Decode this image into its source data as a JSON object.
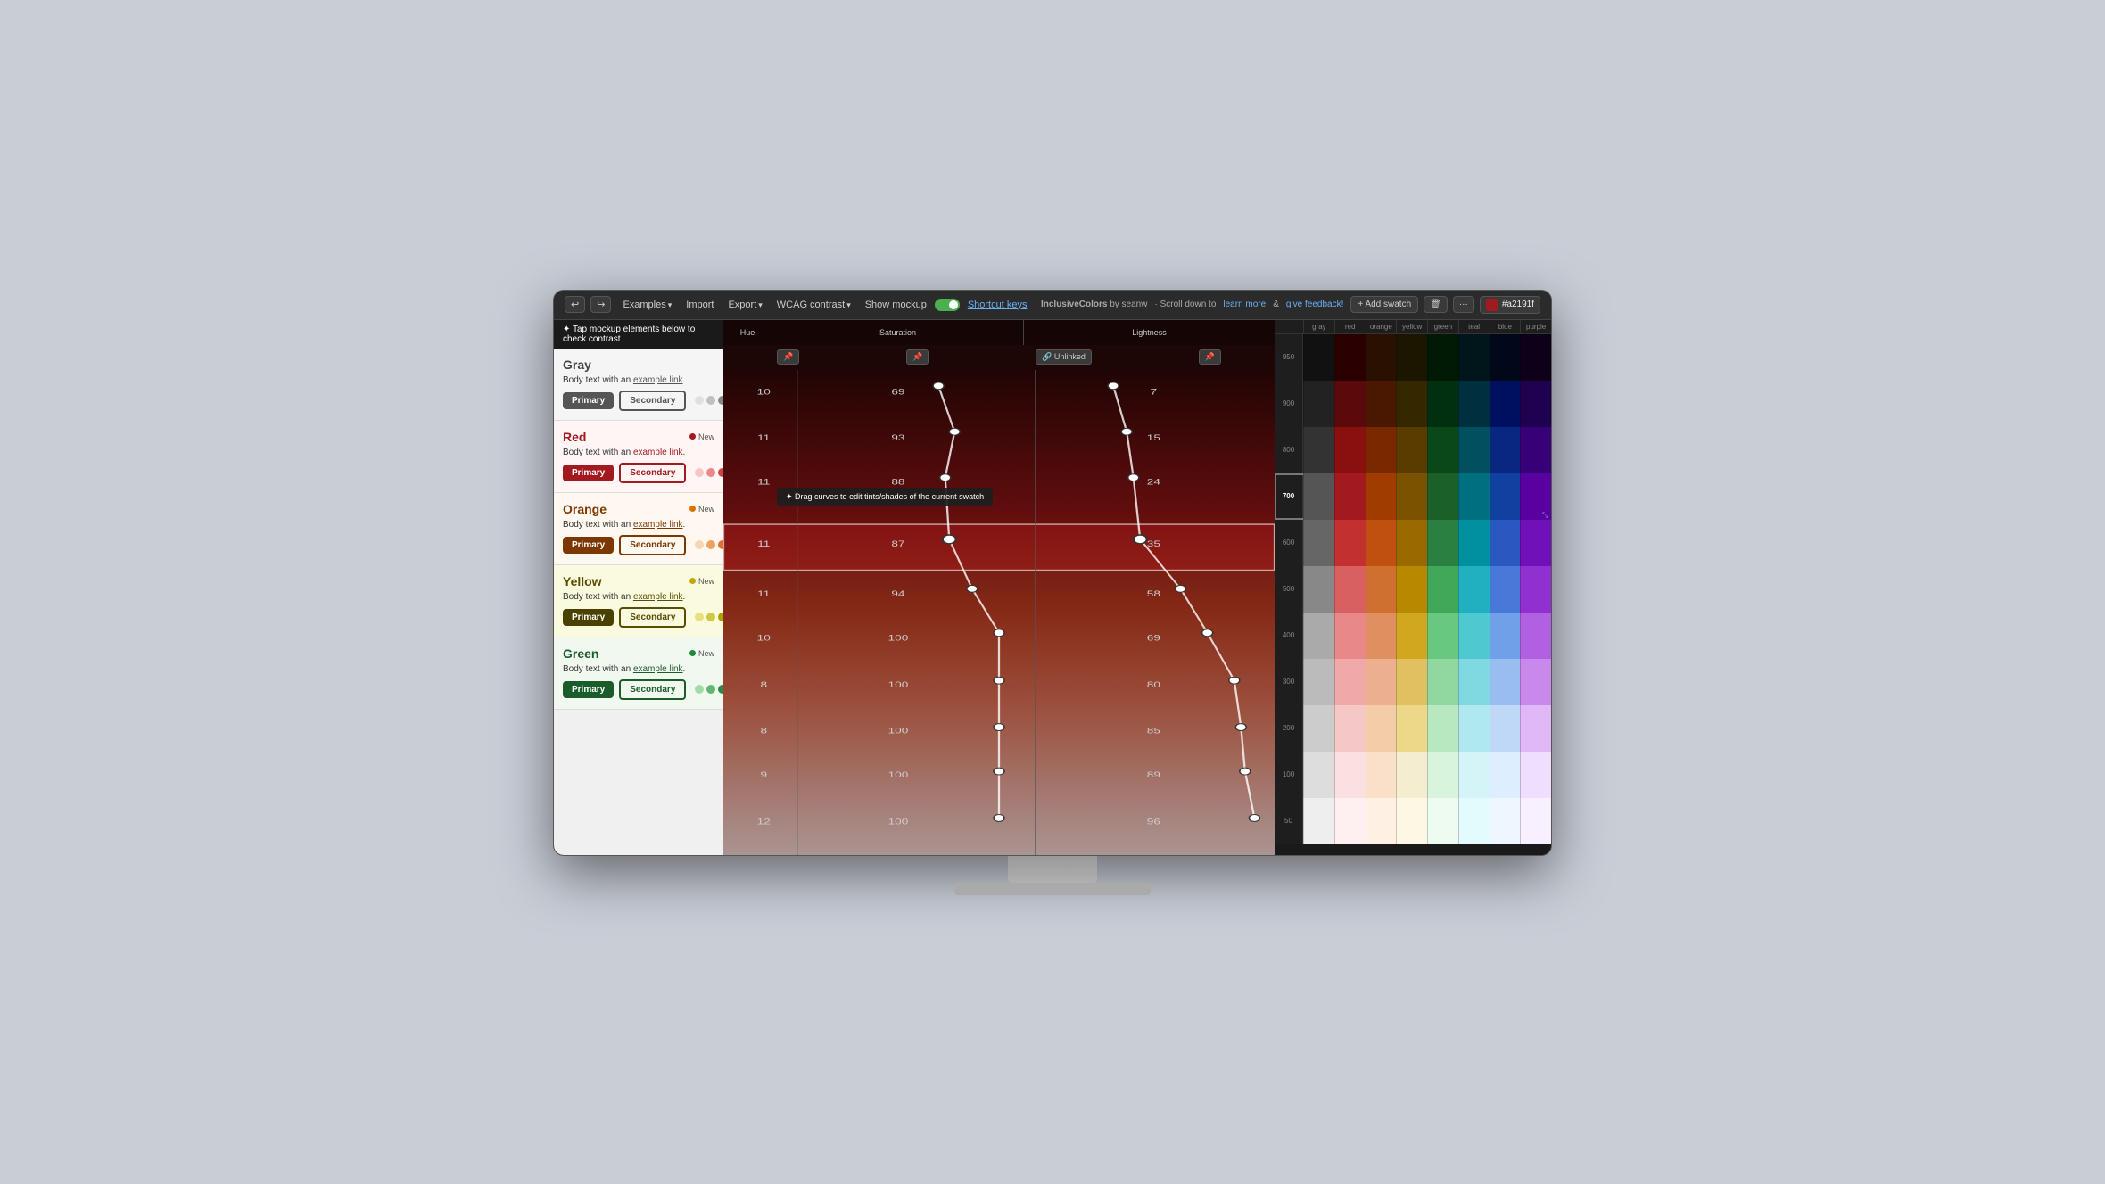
{
  "app": {
    "title": "InclusiveColors",
    "attribution": "by seanw",
    "scroll_hint": "· Scroll down to",
    "learn_more": "learn more",
    "and": "&",
    "give_feedback": "give feedback!"
  },
  "topbar": {
    "undo_label": "↩",
    "redo_label": "↪",
    "examples_label": "Examples",
    "import_label": "Import",
    "export_label": "Export",
    "wcag_label": "WCAG contrast",
    "show_mockup_label": "Show mockup",
    "shortcut_keys_label": "Shortcut keys",
    "unlinked_label": "Unlinked",
    "add_swatch_label": "+ Add swatch",
    "current_hex": "#a2191f"
  },
  "hint": {
    "text": "✦ Tap mockup elements below to check contrast"
  },
  "curves": {
    "hue_label": "Hue",
    "saturation_label": "Saturation",
    "lightness_label": "Lightness",
    "tooltip": "✦ Drag curves to edit tints/shades of the current swatch",
    "hue_value": "10",
    "row_values": [
      {
        "hue": "10",
        "sat": "69",
        "light": "7"
      },
      {
        "hue": "11",
        "sat": "93",
        "light": "15"
      },
      {
        "hue": "11",
        "sat": "88",
        "light": "24"
      },
      {
        "hue": "11",
        "sat": "87",
        "light": "35"
      },
      {
        "hue": "11",
        "sat": "94",
        "light": "58"
      },
      {
        "hue": "10",
        "sat": "100",
        "light": "69"
      },
      {
        "hue": "8",
        "sat": "100",
        "light": "80"
      },
      {
        "hue": "8",
        "sat": "100",
        "light": "85"
      },
      {
        "hue": "9",
        "sat": "100",
        "light": "89"
      },
      {
        "hue": "12",
        "sat": "100",
        "light": "96"
      }
    ]
  },
  "color_panels": [
    {
      "id": "gray",
      "name": "Gray",
      "name_class": "gray-name",
      "section_class": "gray-section",
      "show_new": false,
      "new_label": "New",
      "dot_color": "#a2191f",
      "body_text": "Body text with an",
      "link_text": "example link",
      "period": ".",
      "primary_label": "Primary",
      "secondary_label": "Secondary",
      "primary_class": "gray-primary",
      "secondary_class": "gray-secondary",
      "link_class": "gray-link",
      "dots": [
        "#e0e0e0",
        "#c0c0c0",
        "#888",
        "#555"
      ]
    },
    {
      "id": "red",
      "name": "Red",
      "name_class": "red-name",
      "section_class": "red-section",
      "show_new": true,
      "new_label": "New",
      "dot_color": "#a2191f",
      "body_text": "Body text with an",
      "link_text": "example link",
      "period": ".",
      "primary_label": "Primary",
      "secondary_label": "Secondary",
      "primary_class": "red-primary",
      "secondary_class": "red-secondary",
      "link_class": "red-link",
      "dots": [
        "#f5c6c6",
        "#e88",
        "#c44",
        "#a2191f"
      ]
    },
    {
      "id": "orange",
      "name": "Orange",
      "name_class": "orange-name",
      "section_class": "orange-section",
      "show_new": true,
      "new_label": "New",
      "dot_color": "#e07000",
      "body_text": "Body text with an",
      "link_text": "example link",
      "period": ".",
      "primary_label": "Primary",
      "secondary_label": "Secondary",
      "primary_class": "orange-primary",
      "secondary_class": "orange-secondary",
      "link_class": "orange-link",
      "dots": [
        "#f5d6b0",
        "#f0a060",
        "#e07030",
        "#e06010"
      ]
    },
    {
      "id": "yellow",
      "name": "Yellow",
      "name_class": "yellow-name",
      "section_class": "yellow-section",
      "show_new": true,
      "new_label": "New",
      "dot_color": "#c0a800",
      "body_text": "Body text with an",
      "link_text": "example link",
      "period": ".",
      "primary_label": "Primary",
      "secondary_label": "Secondary",
      "primary_class": "yellow-primary",
      "secondary_class": "yellow-secondary",
      "link_class": "yellow-link",
      "dots": [
        "#e8e080",
        "#d0c840",
        "#b0a000",
        "#806000"
      ]
    },
    {
      "id": "green",
      "name": "Green",
      "name_class": "green-name",
      "section_class": "green-section",
      "show_new": true,
      "new_label": "New",
      "dot_color": "#1a8c3a",
      "body_text": "Body text with an",
      "link_text": "example link",
      "period": ".",
      "primary_label": "Primary",
      "secondary_label": "Secondary",
      "primary_class": "green-primary",
      "secondary_class": "green-secondary",
      "link_class": "green-link",
      "dots": [
        "#a0dca8",
        "#60b870",
        "#2a8c40",
        "#1a5c2a"
      ]
    }
  ],
  "shade_columns": [
    "gray",
    "red",
    "orange",
    "yellow",
    "green",
    "teal",
    "blue",
    "purple"
  ],
  "shade_rows": [
    {
      "label": "950",
      "selected": false,
      "colors": [
        "#111",
        "#2a0000",
        "#2a1000",
        "#1a1600",
        "#001a06",
        "#00161a",
        "#00081a",
        "#0d0018"
      ]
    },
    {
      "label": "900",
      "selected": false,
      "colors": [
        "#222",
        "#5a0a0a",
        "#4a1800",
        "#352800",
        "#003010",
        "#003040",
        "#001060",
        "#200050"
      ]
    },
    {
      "label": "800",
      "selected": false,
      "colors": [
        "#333",
        "#8a1010",
        "#7a2800",
        "#5a3c00",
        "#0a4818",
        "#005060",
        "#082880",
        "#380078"
      ]
    },
    {
      "label": "700",
      "selected": true,
      "colors": [
        "#555",
        "#a2191f",
        "#a03c00",
        "#7a5200",
        "#1a6028",
        "#007080",
        "#1040a0",
        "#5800a0"
      ]
    },
    {
      "label": "600",
      "selected": false,
      "colors": [
        "#666",
        "#c23030",
        "#c05010",
        "#9a6a00",
        "#2a8040",
        "#0090a0",
        "#2858c0",
        "#7010b8"
      ]
    },
    {
      "label": "500",
      "selected": false,
      "colors": [
        "#888",
        "#d86060",
        "#d07030",
        "#b88800",
        "#40a858",
        "#20b0c0",
        "#4878d8",
        "#9030d0"
      ]
    },
    {
      "label": "400",
      "selected": false,
      "colors": [
        "#aaa",
        "#e88888",
        "#e09060",
        "#d0a820",
        "#68c880",
        "#50c8d0",
        "#70a0e8",
        "#b060e0"
      ]
    },
    {
      "label": "300",
      "selected": false,
      "colors": [
        "#bbb",
        "#f0a8a8",
        "#ecb090",
        "#e0c060",
        "#90d8a0",
        "#80d8e0",
        "#98bef0",
        "#c888ec"
      ]
    },
    {
      "label": "200",
      "selected": false,
      "colors": [
        "#ccc",
        "#f5c8c8",
        "#f4cca8",
        "#ecd888",
        "#b8e8c0",
        "#b0e8f0",
        "#c0d8f8",
        "#e0b8f8"
      ]
    },
    {
      "label": "100",
      "selected": false,
      "colors": [
        "#ddd",
        "#fae0e0",
        "#fae0c8",
        "#f5edd0",
        "#d8f4dc",
        "#d4f4f8",
        "#dceeff",
        "#f0deff"
      ]
    },
    {
      "label": "50",
      "selected": false,
      "colors": [
        "#eee",
        "#fef0f0",
        "#fff0e4",
        "#fdf8e4",
        "#eefbf0",
        "#e4fbfd",
        "#eef6ff",
        "#f8f0ff"
      ]
    }
  ]
}
